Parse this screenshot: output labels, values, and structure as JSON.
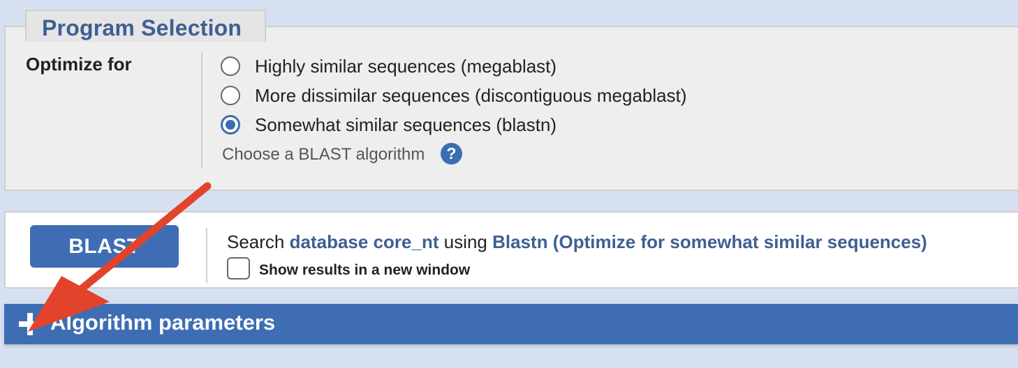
{
  "program_selection": {
    "legend": "Program Selection",
    "optimize_label": "Optimize for",
    "options": [
      {
        "label": "Highly similar sequences (megablast)",
        "checked": false
      },
      {
        "label": "More dissimilar sequences (discontiguous megablast)",
        "checked": false
      },
      {
        "label": "Somewhat similar sequences (blastn)",
        "checked": true
      }
    ],
    "hint": "Choose a BLAST algorithm",
    "help_icon": "?"
  },
  "blast_panel": {
    "button_label": "BLAST",
    "search_prefix": "Search",
    "database_text": "database core_nt",
    "using_text": "using",
    "program_text": "Blastn (Optimize for somewhat similar sequences)",
    "new_window_label": "Show results in a new window",
    "new_window_checked": false
  },
  "algorithm_parameters": {
    "label": "Algorithm parameters",
    "icon": "plus-icon"
  },
  "colors": {
    "accent_blue": "#3e6db4",
    "heading_blue": "#3f5f92",
    "annotation_red": "#e2432b",
    "page_background": "#d6e0f0"
  }
}
